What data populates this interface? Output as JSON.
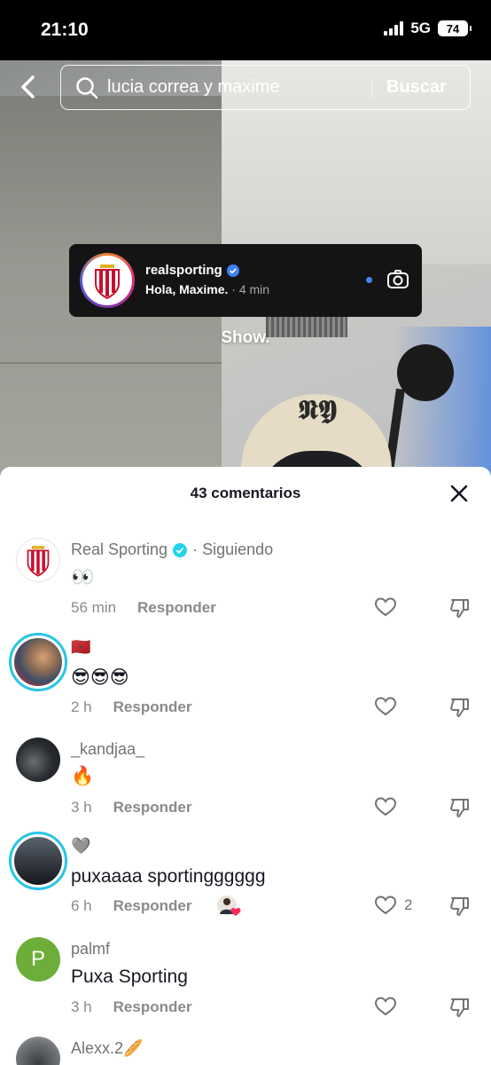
{
  "status": {
    "time": "21:10",
    "network": "5G",
    "battery": "74"
  },
  "search": {
    "query": "lucia correa y maxime",
    "button_label": "Buscar"
  },
  "notification": {
    "username": "realsporting",
    "message": "Hola, Maxime.",
    "time": "· 4 min"
  },
  "video": {
    "caption": "Show."
  },
  "comments_sheet": {
    "title": "43 comentarios",
    "reply_label": "Responder",
    "comments": [
      {
        "user": "Real Sporting",
        "following": " · Siguiendo",
        "text": "👀",
        "time": "56 min",
        "likes": ""
      },
      {
        "user": "🇲🇦",
        "text": "😎😎😎",
        "time": "2 h",
        "likes": ""
      },
      {
        "user": "_kandjaa_",
        "text": "🔥",
        "time": "3 h",
        "likes": ""
      },
      {
        "user": "🩶",
        "text": "puxaaaa sportingggggg",
        "time": "6 h",
        "likes": "2"
      },
      {
        "user": "palmf",
        "avatar_letter": "P",
        "text": "Puxa Sporting",
        "time": "3 h",
        "likes": ""
      },
      {
        "user": "Alexx.2🥖",
        "text": "",
        "time": "",
        "likes": ""
      }
    ]
  },
  "colors": {
    "accent_ring": "#27c5e6",
    "verified": "#20d5ec",
    "palmf_avatar": "#6cae39"
  }
}
